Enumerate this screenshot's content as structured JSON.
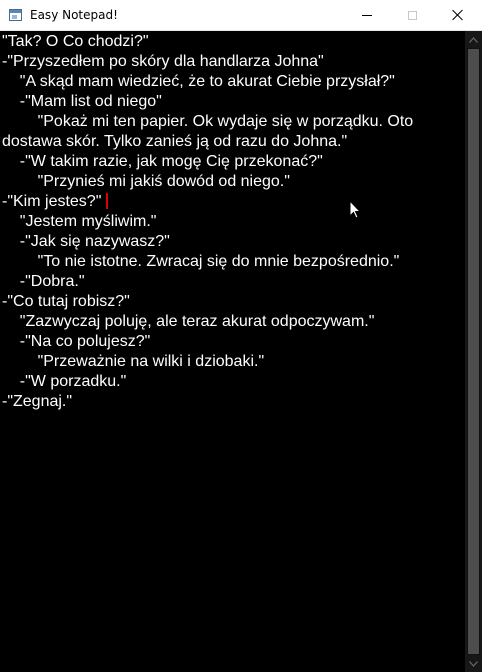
{
  "window": {
    "title": "Easy Notepad!",
    "controls": {
      "minimize": "minimize-icon",
      "maximize": "maximize-icon",
      "close": "close-icon"
    }
  },
  "editor": {
    "lines": [
      "\"Tak? O Co chodzi?\"",
      "-\"Przyszedłem po skóry dla handlarza Johna\"",
      "    \"A skąd mam wiedzieć, że to akurat Ciebie przysłał?\"",
      "    -\"Mam list od niego\"",
      "        \"Pokaż mi ten papier. Ok wydaje się w porządku. Oto",
      "dostawa skór. Tylko zanieś ją od razu do Johna.\"",
      "    -\"W takim razie, jak mogę Cię przekonać?\"",
      "        \"Przynieś mi jakiś dowód od niego.\"",
      "-\"Kim jestes?\"",
      "    \"Jestem myśliwim.\"",
      "    -\"Jak się nazywasz?\"",
      "        \"To nie istotne. Zwracaj się do mnie bezpośrednio.\"",
      "    -\"Dobra.\"",
      "-\"Co tutaj robisz?\"",
      "    \"Zazwyczaj poluję, ale teraz akurat odpoczywam.\"",
      "    -\"Na co polujesz?\"",
      "        \"Przeważnie na wilki i dziobaki.\"",
      "    -\"W porzadku.\"",
      "-\"Zegnaj.\""
    ],
    "text_color": "#ffffff",
    "background": "#000000",
    "caret_color": "#e00000"
  },
  "scrollbar": {
    "up": "scroll-up-arrow-icon",
    "down": "scroll-down-arrow-icon"
  }
}
